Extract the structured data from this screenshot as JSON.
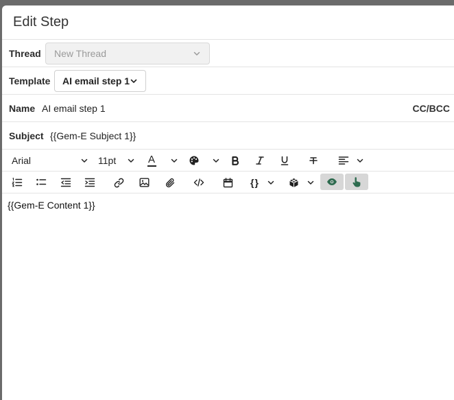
{
  "modal": {
    "title": "Edit Step"
  },
  "thread": {
    "label": "Thread",
    "value": "New Thread"
  },
  "template": {
    "label": "Template",
    "value": "AI email step 1"
  },
  "name": {
    "label": "Name",
    "value": "AI email step 1",
    "ccbcc": "CC/BCC"
  },
  "subject": {
    "label": "Subject",
    "value": "{{Gem-E Subject 1}}"
  },
  "toolbar": {
    "font_family": "Arial",
    "font_size": "11pt",
    "text_color_glyph": "A",
    "icons": [
      "chevron-down-icon",
      "palette-icon",
      "bold-icon",
      "italic-icon",
      "underline-icon",
      "strikethrough-icon",
      "align-left-icon",
      "ordered-list-icon",
      "bullet-list-icon",
      "outdent-icon",
      "indent-icon",
      "link-icon",
      "image-icon",
      "attachment-icon",
      "code-icon",
      "calendar-icon",
      "braces-icon",
      "cube-icon",
      "eye-icon",
      "hand-pointer-icon"
    ],
    "accent_color": "#2e6b4f"
  },
  "editor": {
    "content": "{{Gem-E Content 1}}"
  }
}
